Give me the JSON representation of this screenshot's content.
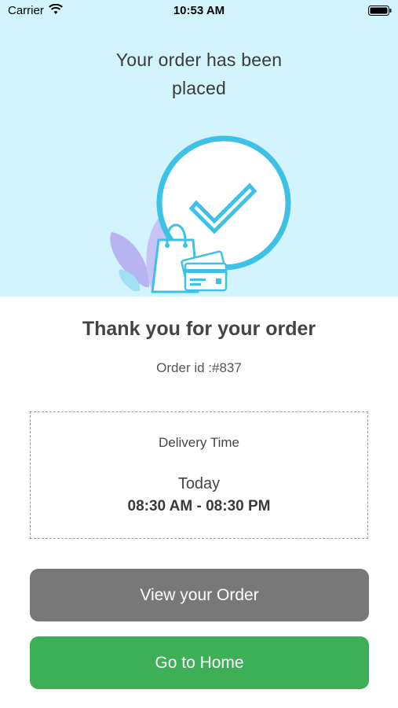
{
  "status_bar": {
    "carrier": "Carrier",
    "time": "10:53 AM",
    "icons": [
      "wifi-icon",
      "battery-icon"
    ]
  },
  "hero": {
    "title_line1": "Your order has been",
    "title_line2": "placed",
    "background_color": "#d3f4fd",
    "illustration": "order-placed-checkmark-shopping-bag-card"
  },
  "confirmation": {
    "title": "Thank you for your order",
    "order_id": "Order id :#837"
  },
  "delivery": {
    "label": "Delivery Time",
    "day": "Today",
    "window": "08:30 AM - 08:30 PM"
  },
  "buttons": {
    "view_order": "View your Order",
    "go_home": "Go to Home"
  },
  "colors": {
    "accent_circle": "#3ec1e6",
    "view_button": "#787878",
    "home_button": "#3daf56"
  }
}
